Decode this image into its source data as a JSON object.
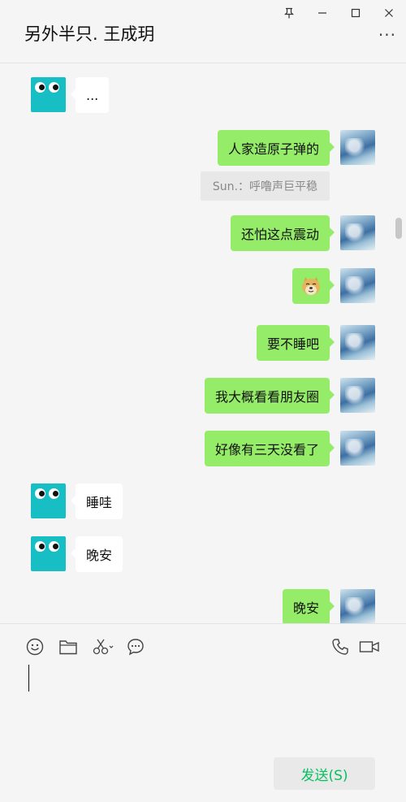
{
  "window": {
    "title": "另外半只. 王成玥",
    "more_label": "···",
    "controls": [
      "pin-icon",
      "minimize-icon",
      "maximize-icon",
      "close-icon"
    ]
  },
  "messages": [
    {
      "side": "friend",
      "text": "..."
    },
    {
      "side": "self",
      "text": "人家造原子弹的"
    },
    {
      "side": "quote",
      "text": "Sun.：呼噜声巨平稳"
    },
    {
      "side": "self",
      "text": "还怕这点震动"
    },
    {
      "side": "self",
      "sticker": "doge-emoji"
    },
    {
      "side": "self",
      "text": "要不睡吧"
    },
    {
      "side": "self",
      "text": "我大概看看朋友圈"
    },
    {
      "side": "self",
      "text": "好像有三天没看了"
    },
    {
      "side": "friend",
      "text": "睡哇"
    },
    {
      "side": "friend",
      "text": "晚安"
    },
    {
      "side": "self",
      "text": "晚安"
    }
  ],
  "toolbar": {
    "left_icons": [
      "emoji-icon",
      "folder-icon",
      "scissors-icon",
      "chat-history-icon"
    ],
    "right_icons": [
      "phone-icon",
      "video-call-icon"
    ]
  },
  "input": {
    "value": ""
  },
  "send_label": "发送(S)",
  "colors": {
    "self_bubble": "#95ec69",
    "friend_bubble": "#ffffff",
    "send_text": "#07c160",
    "background": "#f5f5f5"
  }
}
